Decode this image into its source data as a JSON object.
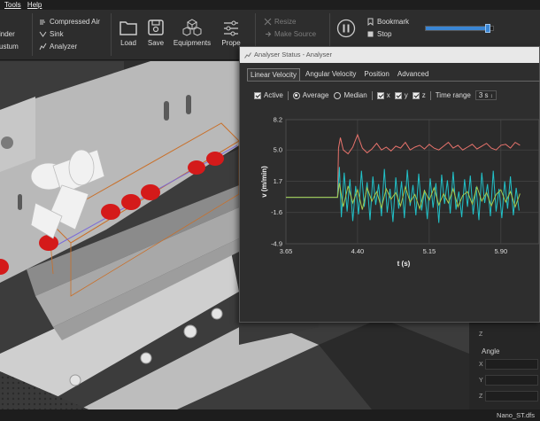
{
  "menu": {
    "tools": "Tools",
    "help": "Help"
  },
  "ribbon": {
    "left_cut_1": "inder",
    "left_cut_2": "ustum",
    "compressed_air": "Compressed Air",
    "sink": "Sink",
    "analyzer": "Analyzer",
    "load": "Load",
    "save": "Save",
    "equipments": "Equipments",
    "properties_cut": "Prope",
    "resize": "Resize",
    "make_source": "Make Source",
    "bookmark": "Bookmark",
    "stop": "Stop",
    "slider_fraction": 0.92
  },
  "analyser": {
    "title": "Analyser Status - Analyser",
    "tabs": [
      "Linear Velocity",
      "Angular Velocity",
      "Position",
      "Advanced"
    ],
    "active_tab": 0,
    "options": {
      "active": "Active",
      "average": "Average",
      "median": "Median",
      "x": "x",
      "y": "y",
      "z": "z",
      "time_range_label": "Time range",
      "time_range_value": "3 s"
    }
  },
  "chart_data": {
    "type": "line",
    "xlabel": "t (s)",
    "ylabel": "v (m/min)",
    "xlim": [
      3.65,
      6.3
    ],
    "ylim": [
      -4.9,
      8.2
    ],
    "xticks": [
      "3.65",
      "4.40",
      "5.15",
      "5.90"
    ],
    "xtick_values": [
      3.65,
      4.4,
      5.15,
      5.9
    ],
    "yticks": [
      "8.2",
      "5.0",
      "1.7",
      "-1.6",
      "-4.9"
    ],
    "ytick_values": [
      8.2,
      5.0,
      1.7,
      -1.6,
      -4.9
    ],
    "grid": true,
    "legend_position": "bottom",
    "colors": {
      "x": "#e8736c",
      "y": "#a6c84a",
      "z": "#21c1c8"
    },
    "series": [
      {
        "name": "x",
        "x": [
          3.65,
          4.19,
          4.2,
          4.22,
          4.25,
          4.3,
          4.35,
          4.4,
          4.45,
          4.5,
          4.55,
          4.6,
          4.65,
          4.7,
          4.75,
          4.8,
          4.85,
          4.9,
          4.95,
          5.0,
          5.05,
          5.1,
          5.15,
          5.2,
          5.25,
          5.3,
          5.35,
          5.4,
          5.45,
          5.5,
          5.55,
          5.6,
          5.65,
          5.7,
          5.75,
          5.8,
          5.85,
          5.9,
          5.95,
          6.0,
          6.05,
          6.1
        ],
        "values": [
          0.0,
          0.0,
          5.2,
          6.3,
          5.0,
          4.6,
          5.3,
          6.6,
          5.2,
          4.7,
          5.1,
          5.7,
          5.0,
          5.3,
          4.9,
          5.4,
          5.2,
          5.8,
          5.0,
          5.3,
          5.5,
          5.1,
          5.6,
          5.2,
          5.0,
          5.4,
          5.8,
          5.2,
          5.5,
          5.0,
          5.3,
          5.6,
          5.1,
          5.4,
          5.7,
          5.2,
          5.0,
          5.5,
          5.6,
          5.2,
          5.8,
          5.5
        ]
      },
      {
        "name": "y",
        "x": [
          3.65,
          4.19,
          4.21,
          4.25,
          4.3,
          4.35,
          4.4,
          4.45,
          4.5,
          4.55,
          4.6,
          4.65,
          4.7,
          4.75,
          4.8,
          4.85,
          4.9,
          4.95,
          5.0,
          5.05,
          5.1,
          5.15,
          5.2,
          5.25,
          5.3,
          5.35,
          5.4,
          5.45,
          5.5,
          5.55,
          5.6,
          5.65,
          5.7,
          5.75,
          5.8,
          5.85,
          5.9,
          5.95,
          6.0,
          6.05,
          6.1
        ],
        "values": [
          0.0,
          0.0,
          1.5,
          -1.0,
          1.2,
          -0.6,
          0.8,
          -1.3,
          1.0,
          -0.4,
          0.6,
          -1.1,
          0.9,
          -0.2,
          0.5,
          -0.9,
          1.1,
          -0.5,
          0.3,
          -1.2,
          0.7,
          -0.3,
          1.0,
          -0.8,
          0.4,
          -0.6,
          0.9,
          -1.0,
          0.2,
          0.6,
          -0.7,
          1.1,
          -0.4,
          0.5,
          -0.9,
          0.3,
          0.8,
          -0.5,
          0.6,
          -1.0,
          0.4
        ]
      },
      {
        "name": "z",
        "x": [
          3.65,
          4.19,
          4.21,
          4.23,
          4.26,
          4.29,
          4.32,
          4.35,
          4.38,
          4.41,
          4.44,
          4.47,
          4.5,
          4.53,
          4.56,
          4.59,
          4.62,
          4.65,
          4.68,
          4.71,
          4.74,
          4.77,
          4.8,
          4.83,
          4.86,
          4.89,
          4.92,
          4.95,
          4.98,
          5.01,
          5.04,
          5.07,
          5.1,
          5.13,
          5.16,
          5.19,
          5.22,
          5.25,
          5.28,
          5.31,
          5.34,
          5.37,
          5.4,
          5.43,
          5.46,
          5.49,
          5.52,
          5.55,
          5.58,
          5.61,
          5.64,
          5.67,
          5.7,
          5.73,
          5.76,
          5.79,
          5.82,
          5.85,
          5.88,
          5.91,
          5.94,
          5.97,
          6.0,
          6.03,
          6.06,
          6.09
        ],
        "values": [
          0.0,
          0.0,
          3.2,
          -2.1,
          2.6,
          -1.5,
          1.9,
          -2.5,
          1.2,
          -1.8,
          2.8,
          -1.0,
          1.6,
          -2.4,
          2.2,
          -0.8,
          1.4,
          -2.0,
          3.0,
          -1.6,
          0.9,
          -2.6,
          2.1,
          -1.2,
          1.7,
          -2.2,
          2.9,
          -0.9,
          1.3,
          -1.9,
          2.5,
          -1.4,
          0.8,
          -2.3,
          2.0,
          -1.1,
          1.5,
          -2.7,
          2.4,
          -0.7,
          1.8,
          -1.7,
          2.7,
          -1.3,
          0.6,
          -2.1,
          1.9,
          -1.0,
          2.3,
          -1.8,
          1.1,
          -2.4,
          2.6,
          -0.6,
          1.4,
          -2.0,
          2.8,
          -1.5,
          0.9,
          -2.2,
          1.7,
          -1.2,
          2.2,
          -1.9,
          1.0,
          -1.4
        ]
      }
    ]
  },
  "side_panel": {
    "angle_header": "Angle",
    "row_x": "X",
    "row_y": "Y",
    "row_z": "Z",
    "row_z_top": "Z"
  },
  "status_bar": {
    "file": "Nano_ST.dfs"
  }
}
